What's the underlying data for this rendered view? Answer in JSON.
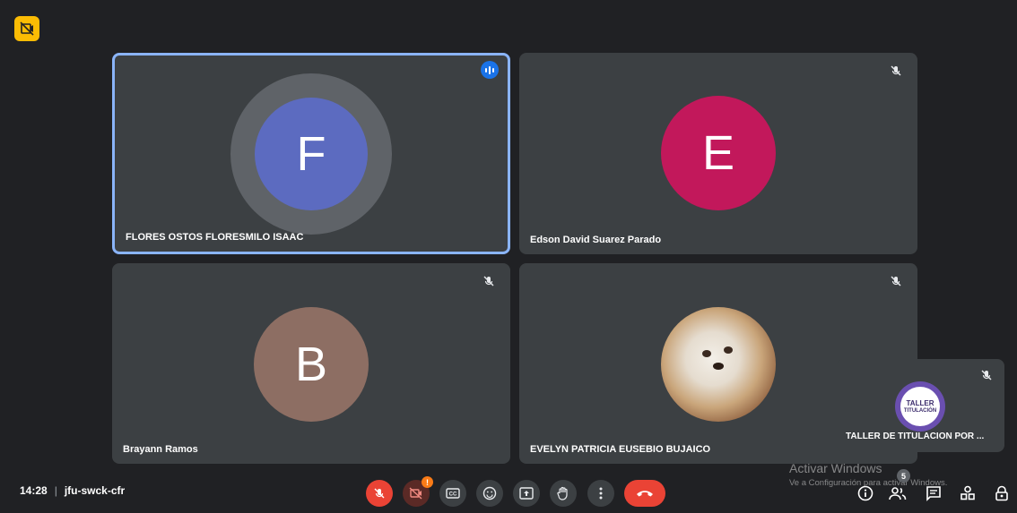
{
  "meeting": {
    "time": "14:28",
    "separator": "|",
    "code": "jfu-swck-cfr"
  },
  "participants": [
    {
      "initial": "F",
      "name": "FLORES OSTOS FLORESMILO ISAAC",
      "avatar_color": "#5c6bc0",
      "speaking": true
    },
    {
      "initial": "E",
      "name": "Edson David Suarez Parado",
      "avatar_color": "#c2185b",
      "muted": true
    },
    {
      "initial": "B",
      "name": "Brayann Ramos",
      "avatar_color": "#8d6e63",
      "muted": true
    },
    {
      "initial": "",
      "name": "EVELYN PATRICIA EUSEBIO BUJAICO",
      "avatar": "photo-of-dog",
      "muted": true
    }
  ],
  "self_view": {
    "name": "TALLER DE TITULACION POR ...",
    "logo_text_1": "TALLER",
    "logo_text_2": "TITULACIÓN",
    "muted": true
  },
  "controls": {
    "mic": "mic-off-icon",
    "camera": "camera-off-icon",
    "camera_badge": "!",
    "captions": "captions-icon",
    "emoji": "emoji-icon",
    "present": "present-icon",
    "hand": "raise-hand-icon",
    "more": "more-vert-icon",
    "leave": "end-call-icon"
  },
  "right_controls": {
    "people_count": "5"
  },
  "watermark": {
    "title": "Activar Windows",
    "subtitle": "Ve a Configuración para activar Windows."
  },
  "colors": {
    "background": "#202124",
    "tile": "#3c4043",
    "accent": "#8ab4f8",
    "danger": "#ea4335",
    "speaking": "#1a73e8"
  }
}
